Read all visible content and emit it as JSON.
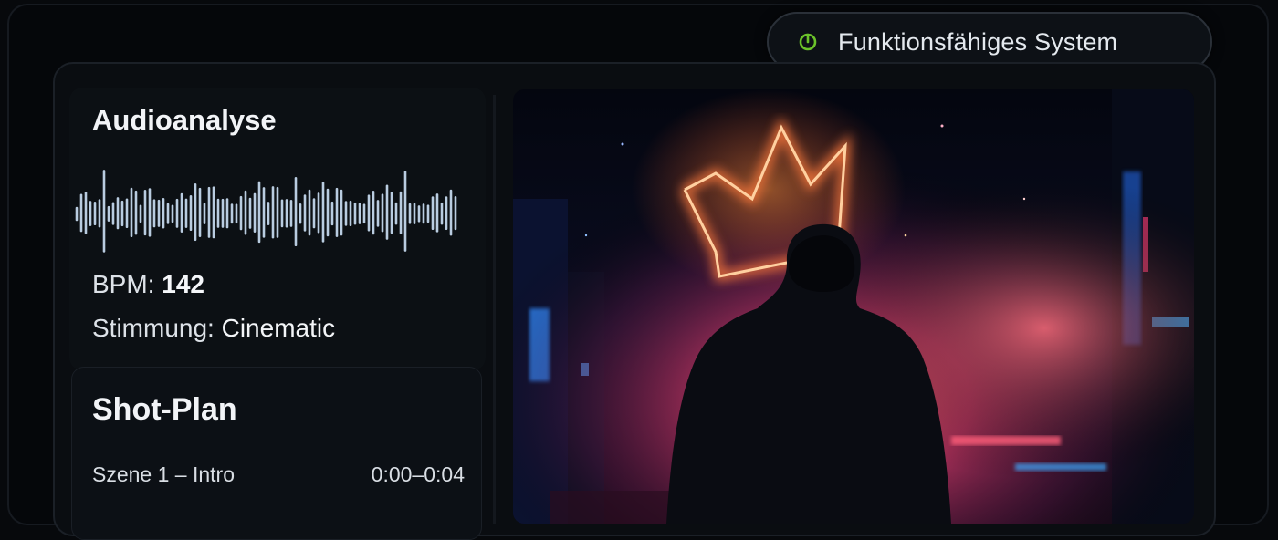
{
  "status": {
    "label": "Funktionsfähiges System",
    "icon": "power-icon",
    "color": "#6bc22a"
  },
  "audio_analysis": {
    "title": "Audioanalyse",
    "bpm_label": "BPM:",
    "bpm_value": "142",
    "mood_label": "Stimmung:",
    "mood_value": "Cinematic",
    "waveform_color": "#b9cce0"
  },
  "shot_plan": {
    "title": "Shot-Plan",
    "scenes": [
      {
        "name": "Szene 1 – Intro",
        "time": "0:00–0:04"
      }
    ]
  },
  "artwork": {
    "subject": "hooded figure in front of neon crown, pink smoke, city lights",
    "accent_colors": [
      "#ff7a3c",
      "#ff4f8e",
      "#2d8bff"
    ]
  }
}
